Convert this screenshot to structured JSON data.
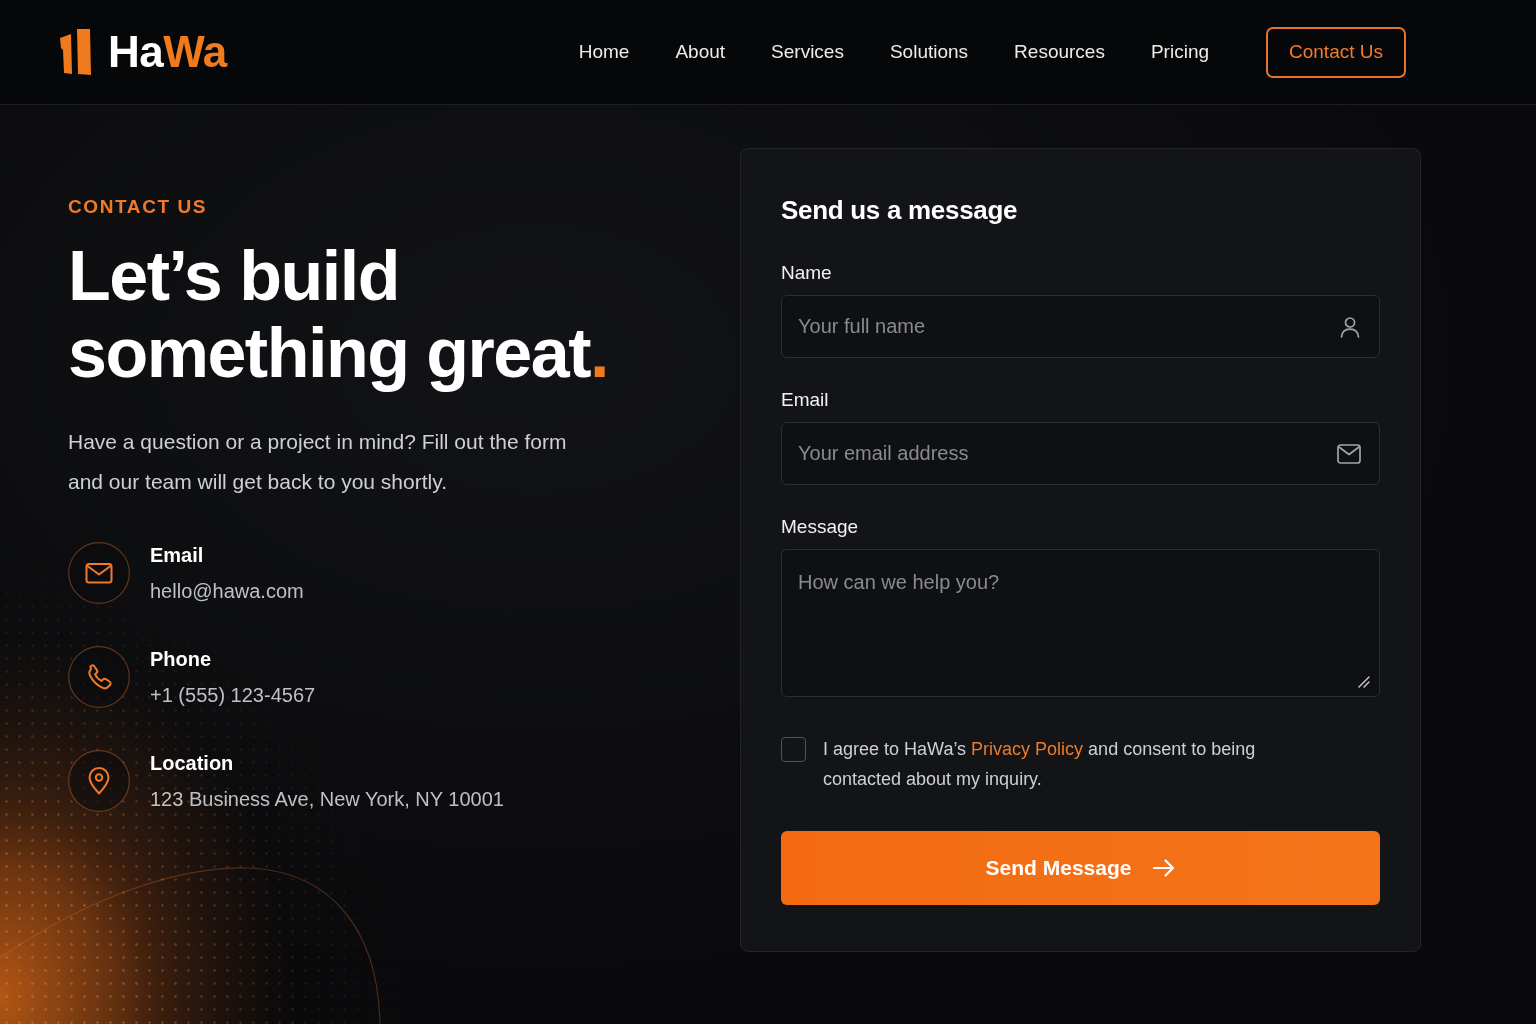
{
  "header": {
    "logo": {
      "text": "Ha",
      "accent": "Wa"
    },
    "nav": [
      {
        "label": "Home"
      },
      {
        "label": "About"
      },
      {
        "label": "Services"
      },
      {
        "label": "Solutions"
      },
      {
        "label": "Resources"
      },
      {
        "label": "Pricing"
      }
    ],
    "cta": {
      "label": "Contact Us"
    }
  },
  "intro": {
    "eyebrow": "CONTACT US",
    "heading": "Let’s build something great",
    "heading_accent": ".",
    "description": "Have a question or a project in mind? Fill out the form and our team will get back to you shortly."
  },
  "contact_items": [
    {
      "kind": "email",
      "label": "Email",
      "value": "hello@hawa.com"
    },
    {
      "kind": "phone",
      "label": "Phone",
      "value": "+1 (555) 123-4567"
    },
    {
      "kind": "location",
      "label": "Location",
      "value": "123 Business Ave, New York, NY 10001"
    }
  ],
  "form": {
    "title": "Send us a message",
    "fields": [
      {
        "kind": "name",
        "label": "Name",
        "placeholder": "Your full name"
      },
      {
        "kind": "email",
        "label": "Email",
        "placeholder": "Your email address"
      },
      {
        "kind": "message",
        "label": "Message",
        "placeholder": "How can we help you?"
      }
    ],
    "consent": {
      "checked": false,
      "text_before": "I agree to HaWa’s",
      "link": "Privacy Policy",
      "text_after": "and consent to being contacted about my inquiry."
    },
    "submit": {
      "label": "Send Message"
    }
  }
}
